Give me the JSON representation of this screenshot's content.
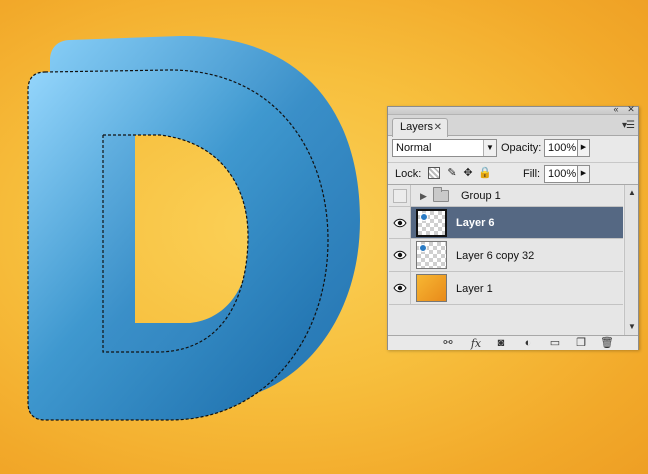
{
  "canvas": {
    "artwork": "letter-d-artwork",
    "background_color": "#f6b73a",
    "letter_color_light": "#8fd3fb",
    "letter_color_dark": "#1d6fae",
    "selection": "marching-ants"
  },
  "layers_panel": {
    "tab_label": "Layers",
    "tab_close_icon": "close-icon",
    "panel_menu_icon": "panel-menu-icon",
    "collapse_icon": "double-chevron-icon",
    "close_icon": "close-icon",
    "blend_mode": "Normal",
    "opacity_label": "Opacity:",
    "opacity_value": "100%",
    "lock_label": "Lock:",
    "lock_icons": [
      "lock-transparent-icon",
      "lock-paint-icon",
      "lock-move-icon",
      "lock-all-icon"
    ],
    "fill_label": "Fill:",
    "fill_value": "100%",
    "selected_color": "#556883",
    "layers": [
      {
        "name": "Group 1",
        "kind": "group",
        "visible": false,
        "selected": false
      },
      {
        "name": "Layer 6",
        "kind": "layer",
        "visible": true,
        "selected": true
      },
      {
        "name": "Layer 6 copy 32",
        "kind": "layer",
        "visible": true,
        "selected": false
      },
      {
        "name": "Layer 1",
        "kind": "layer",
        "visible": true,
        "selected": false
      }
    ],
    "bottom_icons": [
      "link-layers-icon",
      "fx-icon",
      "mask-icon",
      "adjustment-icon",
      "new-group-icon",
      "new-layer-icon",
      "trash-icon"
    ],
    "fx_label": "fx"
  }
}
